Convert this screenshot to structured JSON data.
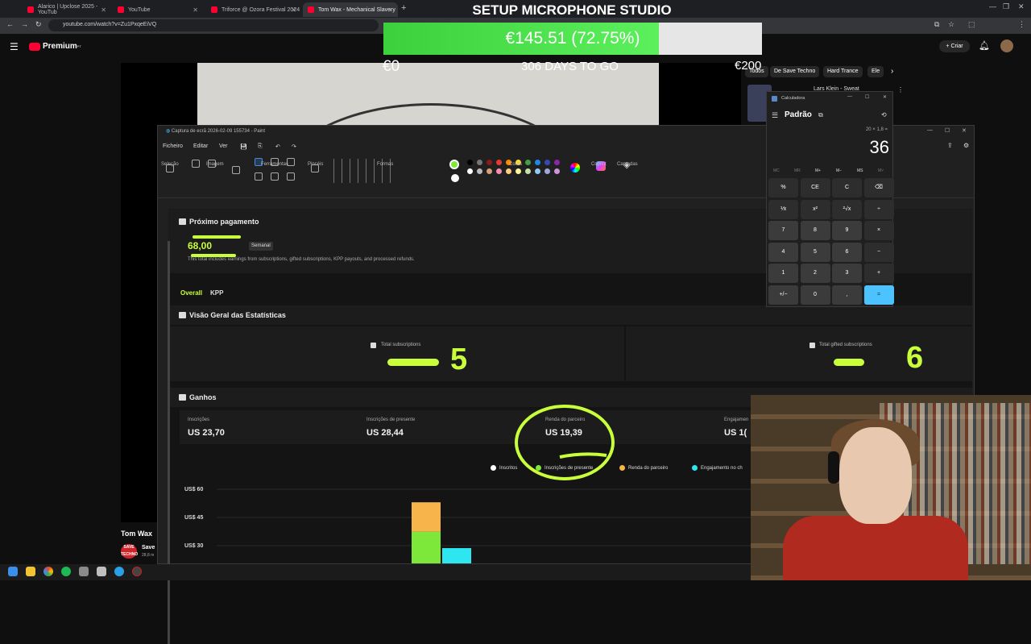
{
  "browser": {
    "tabs": [
      {
        "title": "Alarico | Upclose 2025 - YouTub"
      },
      {
        "title": "YouTube"
      },
      {
        "title": "Triforce @ Ozora Festival 2024"
      },
      {
        "title": "Tom Wax - Mechanical Slavery"
      }
    ],
    "url": "youtube.com/watch?v=Zu1PxqeEiVQ"
  },
  "overlay": {
    "title": "SETUP MICROPHONE STUDIO",
    "goal_text": "€145.51 (72.75%)",
    "goal_progress": 0.7275,
    "goal_min": "€0",
    "goal_days": "306 DAYS TO GO",
    "goal_max": "€200"
  },
  "youtube": {
    "logo": "Premium",
    "logo_sup": "PT",
    "create_label": "Criar",
    "chips": [
      "Todos",
      "De Save Techno",
      "Hard Trance",
      "Ele"
    ],
    "related_title": "Lars Klein - Sweat",
    "channel_title": "Tom Wax",
    "sub_channel": "Save",
    "sub_logo": "SAVE TECHNO",
    "sub_count": "28,8 m"
  },
  "paint": {
    "title": "Captura de ecrã 2026-02-09 155734 - Paint",
    "menu": [
      "Ficheiro",
      "Editar",
      "Ver"
    ],
    "groups": [
      "Seleção",
      "Imagem",
      "Ferramentas",
      "Pincéis",
      "Formas",
      "Cores",
      "Copilot",
      "Camadas"
    ]
  },
  "dashboard": {
    "payment": {
      "title": "Próximo pagamento",
      "amount": "68,00",
      "frequency": "Semanal",
      "note": "This total includes earnings from subscriptions, gifted subscriptions, KPP payouts, and processed refunds."
    },
    "tabs": [
      "Overall",
      "KPP"
    ],
    "stats": {
      "title": "Visão Geral das Estatísticas",
      "total_subscriptions_label": "Total subscriptions",
      "total_subscriptions_value": "5",
      "total_gifted_label": "Total gifted subscriptions",
      "total_gifted_value": "6"
    },
    "earnings": {
      "title": "Ganhos",
      "items": [
        {
          "label": "Inscrições",
          "value": "US  23,70"
        },
        {
          "label": "Inscrições de presente",
          "value": "US  28,44"
        },
        {
          "label": "Renda do parceiro",
          "value": "US  19,39"
        },
        {
          "label": "Engajamen",
          "value": "US  1("
        }
      ]
    },
    "chart_data": {
      "type": "bar",
      "series": [
        {
          "name": "Inscritos",
          "color": "#ffffff",
          "values": [
            null
          ]
        },
        {
          "name": "Inscrições de presente",
          "color": "#7ee83a",
          "values": [
            12
          ]
        },
        {
          "name": "Renda do parceiro",
          "color": "#f6b44b",
          "values": [
            16
          ]
        },
        {
          "name": "Engajamento no ch",
          "color": "#2ee6f0",
          "values": [
            8
          ]
        }
      ],
      "yticks": [
        "US$ 60",
        "US$ 45",
        "US$ 30"
      ],
      "ylim": [
        15,
        60
      ]
    }
  },
  "calculator": {
    "title": "Calculadora",
    "mode": "Padrão",
    "expression": "20 × 1,8 =",
    "display": "36",
    "memory": [
      "MC",
      "MR",
      "M+",
      "M−",
      "MS",
      "M˅"
    ],
    "keys": [
      [
        "%",
        "CE",
        "C",
        "⌫"
      ],
      [
        "⅟x",
        "x²",
        "²√x",
        "÷"
      ],
      [
        "7",
        "8",
        "9",
        "×"
      ],
      [
        "4",
        "5",
        "6",
        "−"
      ],
      [
        "1",
        "2",
        "3",
        "+"
      ],
      [
        "+/−",
        "0",
        ",",
        "="
      ]
    ]
  },
  "colors": {
    "accent": "#c8ff3a",
    "goal_green": "#3cd13c",
    "calc_equals": "#4cc2ff"
  }
}
